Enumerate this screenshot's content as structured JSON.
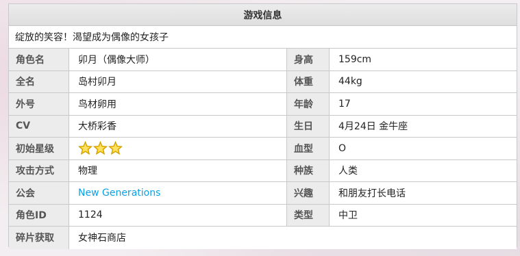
{
  "panel": {
    "title": "游戏信息",
    "subtitle": "绽放的笑容！渴望成为偶像的女孩子"
  },
  "rows": [
    {
      "label1": "角色名",
      "value1": "卯月（偶像大师）",
      "label2": "身高",
      "value2": "159cm"
    },
    {
      "label1": "全名",
      "value1": "岛村卯月",
      "label2": "体重",
      "value2": "44kg"
    },
    {
      "label1": "外号",
      "value1": "鸟材卵用",
      "label2": "年龄",
      "value2": "17"
    },
    {
      "label1": "CV",
      "value1": "大桥彩香",
      "label2": "生日",
      "value2": "4月24日 金牛座"
    },
    {
      "label1": "初始星级",
      "stars": 3,
      "label2": "血型",
      "value2": "O"
    },
    {
      "label1": "攻击方式",
      "value1": "物理",
      "label2": "种族",
      "value2": "人类"
    },
    {
      "label1": "公会",
      "value1": "New Generations",
      "label2": "兴趣",
      "value2": "和朋友打长电话"
    },
    {
      "label1": "角色ID",
      "value1": "1124",
      "label2": "类型",
      "value2": "中卫"
    },
    {
      "label1": "碎片获取",
      "value1": "女神石商店"
    }
  ],
  "colors": {
    "link": "#0aa0e6",
    "star_fill": "#f5c400",
    "star_stroke": "#c99a00",
    "label_bg": "#ececec",
    "border": "#c8c8c8"
  },
  "icons": {
    "star": "star-icon"
  }
}
